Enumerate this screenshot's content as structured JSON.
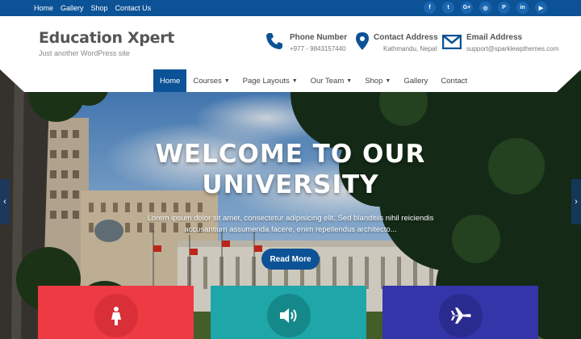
{
  "topbar": {
    "links": [
      "Home",
      "Gallery",
      "Shop",
      "Contact Us"
    ],
    "social": [
      {
        "icon": "facebook-icon",
        "glyph": "f"
      },
      {
        "icon": "twitter-icon",
        "glyph": "t"
      },
      {
        "icon": "google-plus-icon",
        "glyph": "G+"
      },
      {
        "icon": "instagram-icon",
        "glyph": "◎"
      },
      {
        "icon": "pinterest-icon",
        "glyph": "P"
      },
      {
        "icon": "linkedin-icon",
        "glyph": "in"
      },
      {
        "icon": "youtube-icon",
        "glyph": "▶"
      }
    ]
  },
  "header": {
    "site_title": "Education Xpert",
    "tagline": "Just another WordPress site",
    "phone": {
      "label": "Phone Number",
      "value": "+977 - 9843157440"
    },
    "address": {
      "label": "Contact Address",
      "value": "Kathmandu, Nepal"
    },
    "email": {
      "label": "Email Address",
      "value": "support@sparklewpthemes.com"
    }
  },
  "nav": {
    "items": [
      {
        "label": "Home",
        "dropdown": false,
        "active": true
      },
      {
        "label": "Courses",
        "dropdown": true,
        "active": false
      },
      {
        "label": "Page Layouts",
        "dropdown": true,
        "active": false
      },
      {
        "label": "Our Team",
        "dropdown": true,
        "active": false
      },
      {
        "label": "Shop",
        "dropdown": true,
        "active": false
      },
      {
        "label": "Gallery",
        "dropdown": false,
        "active": false
      },
      {
        "label": "Contact",
        "dropdown": false,
        "active": false
      }
    ]
  },
  "hero": {
    "title_line1": "WELCOME TO OUR",
    "title_line2": "UNIVERSITY",
    "text": "Lorem ipsum dolor sit amet, consectetur adipisicing elit. Sed blanditiis nihil reiciendis accusantium assumenda facere, enim repellendus architecto...",
    "button": "Read More",
    "prev_icon": "chevron-left-icon",
    "next_icon": "chevron-right-icon"
  },
  "features": [
    {
      "icon": "female-icon",
      "color": "#ee3a43"
    },
    {
      "icon": "volume-icon",
      "color": "#1fa6a8"
    },
    {
      "icon": "plane-icon",
      "color": "#3435a8"
    }
  ],
  "colors": {
    "primary": "#0c5296",
    "topbar": "#0c5296"
  }
}
